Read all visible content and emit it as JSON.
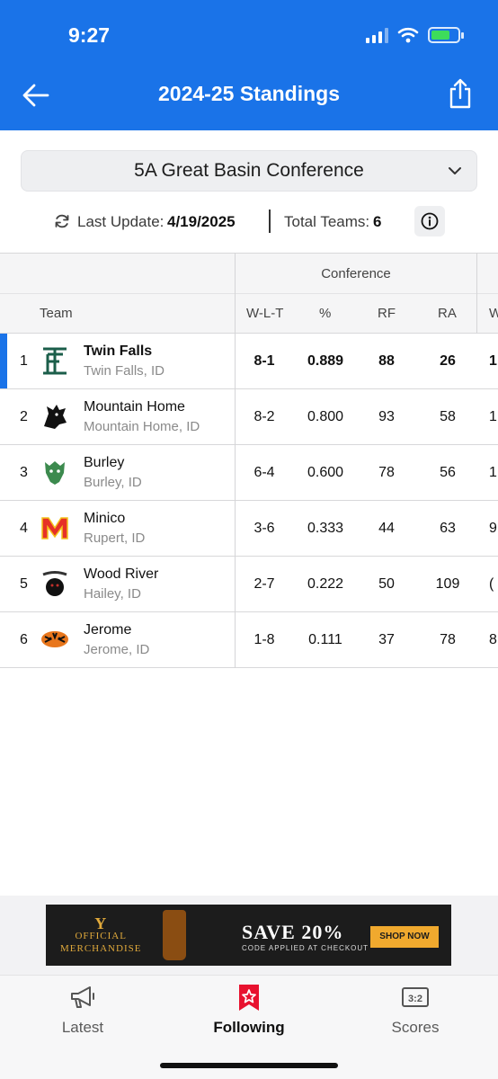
{
  "status": {
    "time": "9:27"
  },
  "header": {
    "title": "2024-25 Standings"
  },
  "conference_select": {
    "selected": "5A Great Basin Conference"
  },
  "meta": {
    "last_update_label": "Last Update:",
    "last_update_value": "4/19/2025",
    "total_teams_label": "Total Teams:",
    "total_teams_value": "6"
  },
  "table": {
    "group_header": "Conference",
    "columns": {
      "team": "Team",
      "wlt": "W-L-T",
      "pct": "%",
      "rf": "RF",
      "ra": "RA",
      "w": "W"
    },
    "rows": [
      {
        "rank": "1",
        "name": "Twin Falls",
        "location": "Twin Falls, ID",
        "wlt": "8-1",
        "pct": "0.889",
        "rf": "88",
        "ra": "26",
        "w": "1"
      },
      {
        "rank": "2",
        "name": "Mountain Home",
        "location": "Mountain Home, ID",
        "wlt": "8-2",
        "pct": "0.800",
        "rf": "93",
        "ra": "58",
        "w": "1"
      },
      {
        "rank": "3",
        "name": "Burley",
        "location": "Burley, ID",
        "wlt": "6-4",
        "pct": "0.600",
        "rf": "78",
        "ra": "56",
        "w": "1"
      },
      {
        "rank": "4",
        "name": "Minico",
        "location": "Rupert, ID",
        "wlt": "3-6",
        "pct": "0.333",
        "rf": "44",
        "ra": "63",
        "w": "9"
      },
      {
        "rank": "5",
        "name": "Wood River",
        "location": "Hailey, ID",
        "wlt": "2-7",
        "pct": "0.222",
        "rf": "50",
        "ra": "109",
        "w": "("
      },
      {
        "rank": "6",
        "name": "Jerome",
        "location": "Jerome, ID",
        "wlt": "1-8",
        "pct": "0.111",
        "rf": "37",
        "ra": "78",
        "w": "8"
      }
    ]
  },
  "ad": {
    "merch_line1": "OFFICIAL",
    "merch_line2": "MERCHANDISE",
    "headline": "SAVE 20%",
    "subline": "CODE APPLIED AT CHECKOUT",
    "cta": "SHOP NOW"
  },
  "tabs": [
    {
      "label": "Latest",
      "icon": "megaphone-icon"
    },
    {
      "label": "Following",
      "icon": "star-bookmark-icon"
    },
    {
      "label": "Scores",
      "icon": "scoreboard-icon"
    }
  ],
  "colors": {
    "accent": "#1a73e8",
    "battery": "#3ddc5b",
    "following": "#e8122f"
  }
}
